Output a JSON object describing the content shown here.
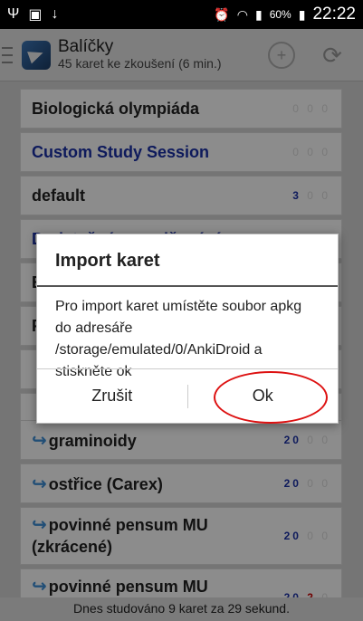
{
  "status_bar": {
    "time": "22:22",
    "battery": "60%"
  },
  "action_bar": {
    "title": "Balíčky",
    "subtitle": "45 karet ke zkoušení (6 min.)"
  },
  "decks": [
    {
      "name": "Biologická olympiáda",
      "style": "bold",
      "new": "0",
      "lrn": "0",
      "rev": "0"
    },
    {
      "name": "Custom Study Session",
      "style": "blue",
      "new": "0",
      "lrn": "0",
      "rev": "0"
    },
    {
      "name": "default",
      "style": "bold",
      "new": "3",
      "lrn": "0",
      "rev": "0"
    },
    {
      "name": "Dodatečné procvičování",
      "style": "blue",
      "new": "0",
      "lrn": "0",
      "rev": "0"
    },
    {
      "name": "E",
      "style": "bold"
    },
    {
      "name": "F",
      "style": "bold"
    },
    {
      "name": "graminoidy",
      "style": "sub",
      "new": "20",
      "lrn": "0",
      "rev": "0"
    },
    {
      "name": "ostřice (Carex)",
      "style": "sub",
      "new": "20",
      "lrn": "0",
      "rev": "0"
    },
    {
      "name": "povinné pensum MU (zkrácené)",
      "style": "sub",
      "new": "20",
      "lrn": "0",
      "rev": "0"
    },
    {
      "name": "povinné pensum MU (základní)",
      "style": "sub",
      "new": "20",
      "lrn": "2",
      "rev": "0"
    }
  ],
  "footer": {
    "text": "Dnes studováno 9 karet za 29 sekund."
  },
  "dialog": {
    "title": "Import karet",
    "message": "Pro import karet umístěte soubor apkg do adresáře /storage/emulated/0/AnkiDroid a stiskněte ok",
    "cancel_label": "Zrušit",
    "ok_label": "Ok"
  },
  "colors": {
    "accent_blue": "#1b31a8",
    "learning_red": "#cc0000",
    "annotation_red": "#dd1111"
  }
}
